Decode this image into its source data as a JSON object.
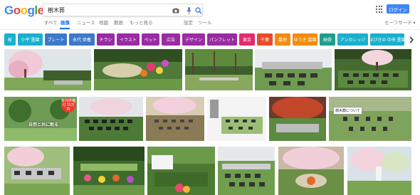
{
  "header": {
    "logo_letters": [
      {
        "ch": "G",
        "color": "#4285f4"
      },
      {
        "ch": "o",
        "color": "#ea4335"
      },
      {
        "ch": "o",
        "color": "#fbbc05"
      },
      {
        "ch": "g",
        "color": "#4285f4"
      },
      {
        "ch": "l",
        "color": "#34a853"
      },
      {
        "ch": "e",
        "color": "#ea4335"
      }
    ],
    "search_value": "樹木葬",
    "login_label": "ログイン"
  },
  "tabs": {
    "all": "すべて",
    "images": "画像",
    "news": "ニュース",
    "maps": "地図",
    "videos": "動画",
    "more": "もっと見る",
    "settings": "設定",
    "tools": "ツール",
    "safesearch": "セーフサーチ ▾"
  },
  "chips": [
    {
      "label": "桜",
      "color": "#1ab0cd"
    },
    {
      "label": "小平 霊園",
      "color": "#1ab0cd"
    },
    {
      "label": "プレート",
      "color": "#3d78c9"
    },
    {
      "label": "永代 供養",
      "color": "#3d78c9"
    },
    {
      "label": "チラシ",
      "color": "#9a2ba3"
    },
    {
      "label": "イラスト",
      "color": "#9a2ba3"
    },
    {
      "label": "ペット",
      "color": "#9a2ba3"
    },
    {
      "label": "広告",
      "color": "#9a2ba3"
    },
    {
      "label": "デザイン",
      "color": "#9a2ba3"
    },
    {
      "label": "パンフレット",
      "color": "#9a2ba3"
    },
    {
      "label": "東京",
      "color": "#e32b6b"
    },
    {
      "label": "千葉",
      "color": "#e84b2a"
    },
    {
      "label": "墓地",
      "color": "#f08c11"
    },
    {
      "label": "ゆうき 墓園",
      "color": "#f08c11"
    },
    {
      "label": "納骨",
      "color": "#1f9e8a"
    },
    {
      "label": "アンカレッジ",
      "color": "#1ab0cd"
    },
    {
      "label": "はびきの 中央 霊園",
      "color": "#1ab0cd"
    }
  ],
  "overlays": {
    "garden_text": "自然と共に眠る",
    "badge_text": "永代供養付 25万円",
    "sign_text": "樹木葬について"
  },
  "colors": {
    "accent_blue": "#1a73e8",
    "login_blue": "#4285f4"
  }
}
